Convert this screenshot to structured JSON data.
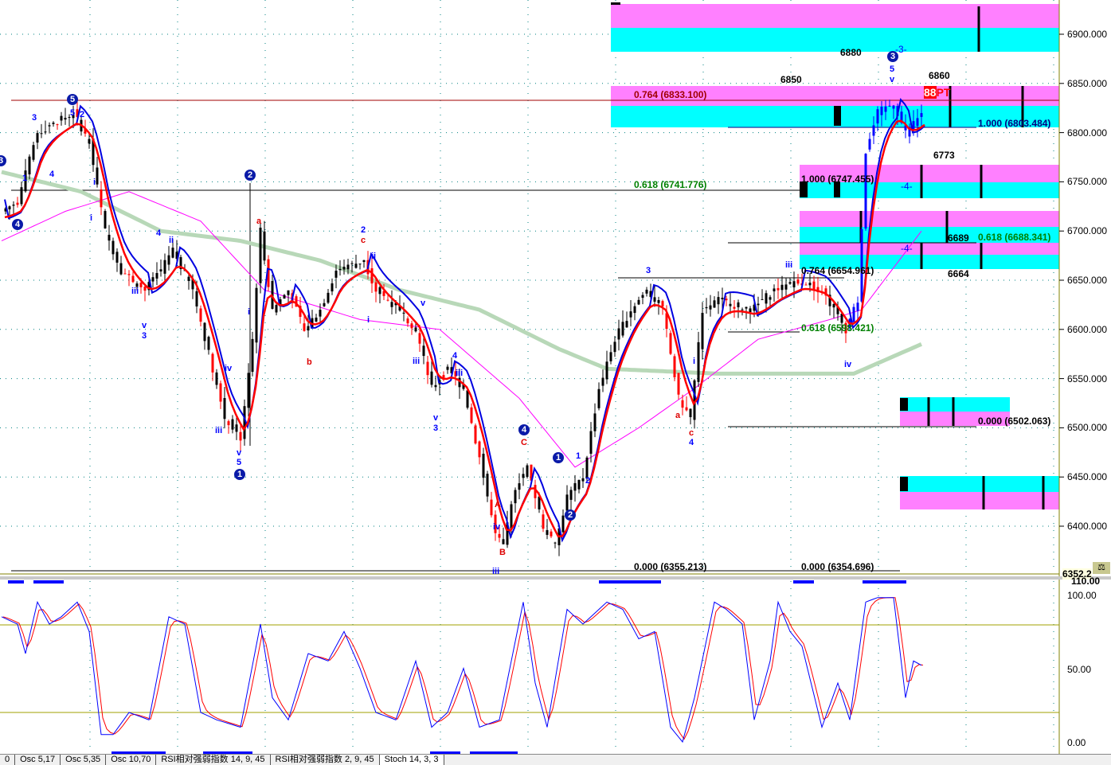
{
  "colors": {
    "price": "#000000",
    "up": "#0000ff",
    "down": "#ff0000",
    "blue_band": "#0000e0",
    "red_band": "#ff0000",
    "green_ma": "#b8d8b8",
    "magenta_ma": "#ff00ff",
    "cyan": "#00ffff",
    "pink": "#ff80ff"
  },
  "chart_data": [
    {
      "type": "line",
      "title": "Price",
      "ylim": [
        6340,
        6925
      ],
      "yticks": [
        "6900.000",
        "6850.000",
        "6800.000",
        "6750.000",
        "6700.000",
        "6650.000",
        "6600.000",
        "6550.000",
        "6500.000",
        "6450.000",
        "6400.000"
      ],
      "last_price_label": "6352.2",
      "price": [
        [
          0,
          6720
        ],
        [
          4,
          6730
        ],
        [
          9,
          6800
        ],
        [
          18,
          6820
        ],
        [
          22,
          6790
        ],
        [
          26,
          6700
        ],
        [
          30,
          6660
        ],
        [
          36,
          6640
        ],
        [
          40,
          6660
        ],
        [
          43,
          6680
        ],
        [
          48,
          6640
        ],
        [
          53,
          6560
        ],
        [
          56,
          6510
        ],
        [
          60,
          6490
        ],
        [
          63,
          6590
        ],
        [
          65,
          6700
        ],
        [
          68,
          6620
        ],
        [
          72,
          6640
        ],
        [
          76,
          6600
        ],
        [
          80,
          6620
        ],
        [
          84,
          6660
        ],
        [
          91,
          6670
        ],
        [
          94,
          6640
        ],
        [
          100,
          6620
        ],
        [
          104,
          6600
        ],
        [
          108,
          6540
        ],
        [
          112,
          6560
        ],
        [
          116,
          6540
        ],
        [
          120,
          6470
        ],
        [
          124,
          6390
        ],
        [
          126,
          6380
        ],
        [
          129,
          6440
        ],
        [
          132,
          6460
        ],
        [
          136,
          6400
        ],
        [
          139,
          6380
        ],
        [
          142,
          6430
        ],
        [
          146,
          6450
        ],
        [
          150,
          6540
        ],
        [
          154,
          6590
        ],
        [
          158,
          6620
        ],
        [
          162,
          6640
        ],
        [
          166,
          6620
        ],
        [
          170,
          6530
        ],
        [
          173,
          6510
        ],
        [
          176,
          6620
        ],
        [
          180,
          6630
        ],
        [
          188,
          6620
        ],
        [
          194,
          6640
        ],
        [
          200,
          6650
        ],
        [
          206,
          6640
        ],
        [
          212,
          6600
        ],
        [
          215,
          6630
        ],
        [
          217,
          6780
        ],
        [
          220,
          6820
        ],
        [
          224,
          6830
        ],
        [
          227,
          6800
        ],
        [
          231,
          6820
        ]
      ],
      "green_ma": [
        [
          0,
          6760
        ],
        [
          20,
          6740
        ],
        [
          40,
          6700
        ],
        [
          60,
          6690
        ],
        [
          80,
          6670
        ],
        [
          100,
          6640
        ],
        [
          120,
          6620
        ],
        [
          140,
          6580
        ],
        [
          152,
          6560
        ],
        [
          180,
          6555
        ],
        [
          214,
          6555
        ],
        [
          231,
          6585
        ]
      ],
      "magenta_ma": [
        [
          0,
          6690
        ],
        [
          16,
          6720
        ],
        [
          32,
          6740
        ],
        [
          50,
          6710
        ],
        [
          66,
          6640
        ],
        [
          90,
          6610
        ],
        [
          110,
          6600
        ],
        [
          130,
          6530
        ],
        [
          144,
          6460
        ],
        [
          160,
          6500
        ],
        [
          174,
          6540
        ],
        [
          190,
          6590
        ],
        [
          208,
          6610
        ],
        [
          216,
          6620
        ],
        [
          231,
          6700
        ]
      ]
    },
    {
      "type": "line",
      "title": "Stoch 14,3,3",
      "ylim": [
        0,
        100
      ],
      "yticks": [
        "100.00",
        "50.00",
        "0.00"
      ],
      "top_label": "110.00",
      "level_lines": [
        80,
        20
      ],
      "k": [
        [
          0,
          85
        ],
        [
          4,
          80
        ],
        [
          6,
          60
        ],
        [
          9,
          95
        ],
        [
          12,
          80
        ],
        [
          15,
          85
        ],
        [
          19,
          95
        ],
        [
          22,
          75
        ],
        [
          25,
          5
        ],
        [
          28,
          5
        ],
        [
          32,
          20
        ],
        [
          37,
          15
        ],
        [
          42,
          85
        ],
        [
          46,
          80
        ],
        [
          50,
          20
        ],
        [
          54,
          15
        ],
        [
          60,
          10
        ],
        [
          65,
          80
        ],
        [
          68,
          30
        ],
        [
          72,
          15
        ],
        [
          77,
          60
        ],
        [
          82,
          55
        ],
        [
          86,
          75
        ],
        [
          90,
          50
        ],
        [
          94,
          20
        ],
        [
          99,
          15
        ],
        [
          104,
          55
        ],
        [
          108,
          10
        ],
        [
          112,
          20
        ],
        [
          116,
          50
        ],
        [
          120,
          10
        ],
        [
          125,
          15
        ],
        [
          131,
          95
        ],
        [
          134,
          40
        ],
        [
          137,
          10
        ],
        [
          142,
          90
        ],
        [
          146,
          80
        ],
        [
          152,
          95
        ],
        [
          156,
          90
        ],
        [
          160,
          70
        ],
        [
          164,
          75
        ],
        [
          168,
          10
        ],
        [
          171,
          0
        ],
        [
          174,
          30
        ],
        [
          179,
          95
        ],
        [
          182,
          90
        ],
        [
          186,
          80
        ],
        [
          189,
          15
        ],
        [
          193,
          55
        ],
        [
          195,
          95
        ],
        [
          198,
          75
        ],
        [
          201,
          65
        ],
        [
          206,
          10
        ],
        [
          210,
          40
        ],
        [
          213,
          15
        ],
        [
          217,
          95
        ],
        [
          220,
          98
        ],
        [
          224,
          98
        ],
        [
          227,
          30
        ],
        [
          229,
          55
        ],
        [
          231,
          52
        ]
      ]
    }
  ],
  "fibs": {
    "f1": "0.764  (6833.100)",
    "f2": "0.618  (6741.776)",
    "f3": "0.000  (6355.213)",
    "f4": "0.000  (6354.696)",
    "f5": "1.000  (6803.484)",
    "f6": "1.000  (6747.455)",
    "f7": "0.618  (6688.341)",
    "f8": "0.764  (6654.961)",
    "f9": "0.618  (6598.421)",
    "f10": "0.000  (6502.063)"
  },
  "levels": {
    "l6880": "6880",
    "l6850": "6850",
    "l6860": "6860",
    "l6773": "6773",
    "l6689": "6689",
    "l6664": "6664",
    "pt": "PT",
    "pt_num": "88",
    "m4a": "-4-",
    "m4b": "-4-",
    "m3": "-3-"
  },
  "waves": {
    "c5": "5",
    "c3a": "3",
    "c4a": "4",
    "c2": "2",
    "c1a": "1",
    "c4b": "4",
    "c1b": "1",
    "c2b": "2",
    "c3b": "3",
    "c3c": "3",
    "w1": "3",
    "w2": "5",
    "w3": "2",
    "w4": "1",
    "w5": "4",
    "w6": "i",
    "w7": "i",
    "w8": "iii",
    "w9": "v",
    "w10": "3",
    "w11": "4",
    "w12": "ii",
    "w13": "iv",
    "w14": "iii",
    "w15": "v",
    "w16": "5",
    "w17": "a",
    "w18": "b",
    "w19": "2",
    "w20": "c",
    "w21": "i",
    "w22": "ii",
    "w23": "v",
    "w24": "iii",
    "w25": "4",
    "w26": "v",
    "w27": "3",
    "w28": "C",
    "w29": "A",
    "w30": "B",
    "w31": "iv",
    "w32": "iii",
    "w33": "2",
    "w34": "1",
    "w35": "3",
    "w36": "i",
    "w37": "a",
    "w38": "c",
    "w39": "4",
    "w40": "iii",
    "w41": "iv",
    "w42": "5",
    "w43": "v",
    "w44": "iii",
    "w45": "ii",
    "w46": "i"
  },
  "tabs": [
    "0",
    "Osc 5,17",
    "Osc 5,35",
    "Osc 10,70",
    "RSI相对强弱指数 14, 9, 45",
    "RSI相对强弱指数 2, 9, 45",
    "Stoch 14, 3, 3"
  ]
}
